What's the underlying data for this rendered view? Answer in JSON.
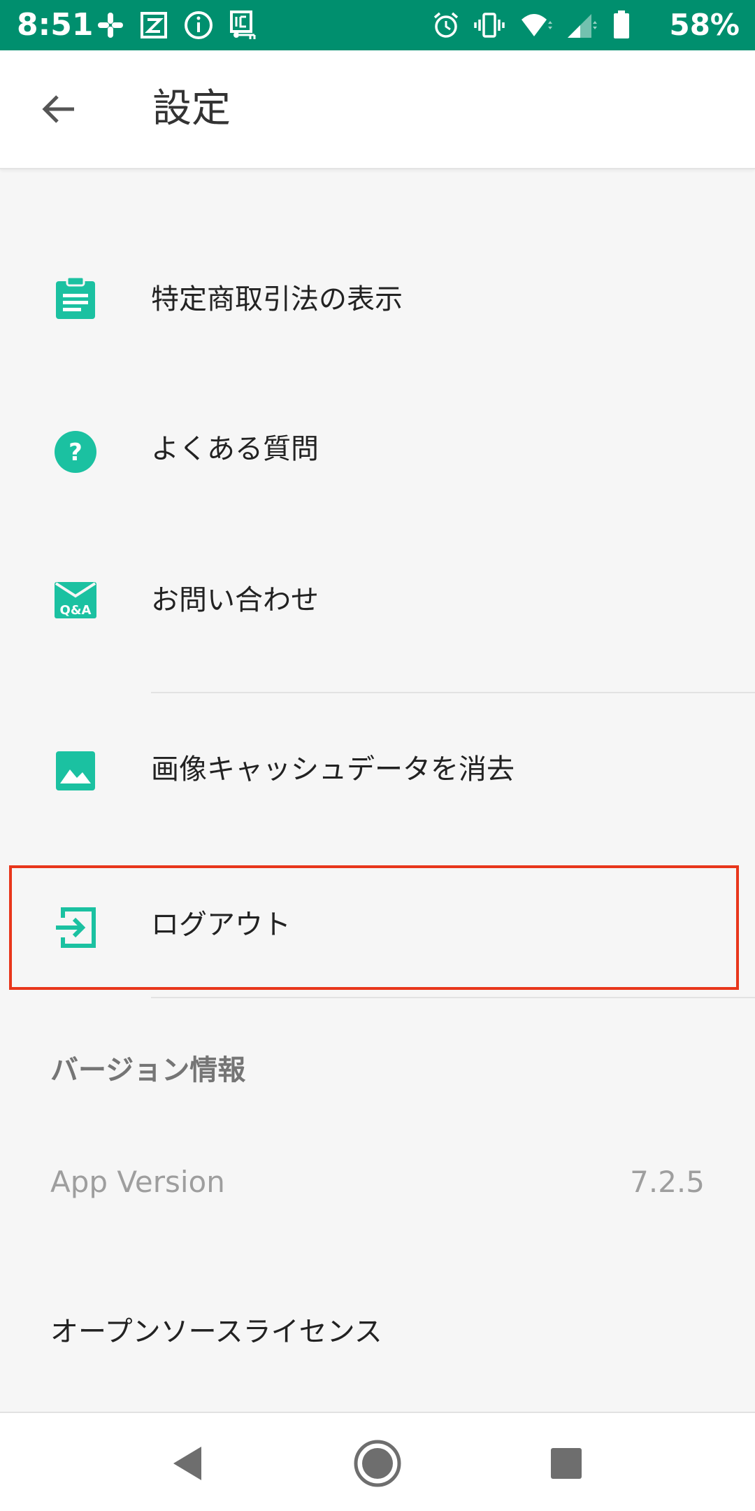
{
  "status_bar": {
    "time": "8:51",
    "battery_percent": "58%",
    "background_color": "#008f6e",
    "left_icons": [
      "slack-icon",
      "z-app-icon",
      "info-icon",
      "ic-card-icon"
    ],
    "right_icons": [
      "alarm-icon",
      "vibrate-icon",
      "wifi-icon",
      "signal-icon",
      "battery-icon"
    ]
  },
  "app_bar": {
    "title": "設定",
    "back_icon": "arrow-left-icon"
  },
  "accent_color": "#1bc1a1",
  "menu": {
    "items": [
      {
        "label": "特定商取引法の表示",
        "icon": "clipboard-icon"
      },
      {
        "label": "よくある質問",
        "icon": "help-circle-icon"
      },
      {
        "label": "お問い合わせ",
        "icon": "qa-mail-icon",
        "icon_text": "Q&A"
      },
      {
        "label": "画像キャッシュデータを消去",
        "icon": "image-icon"
      },
      {
        "label": "ログアウト",
        "icon": "logout-icon"
      }
    ]
  },
  "highlight_color": "#e8361b",
  "version_section": {
    "header": "バージョン情報",
    "app_version_label": "App Version",
    "app_version_value": "7.2.5",
    "oss_label": "オープンソースライセンス"
  },
  "nav_bar": {
    "buttons": [
      "back-triangle-icon",
      "home-circle-icon",
      "recents-square-icon"
    ]
  }
}
